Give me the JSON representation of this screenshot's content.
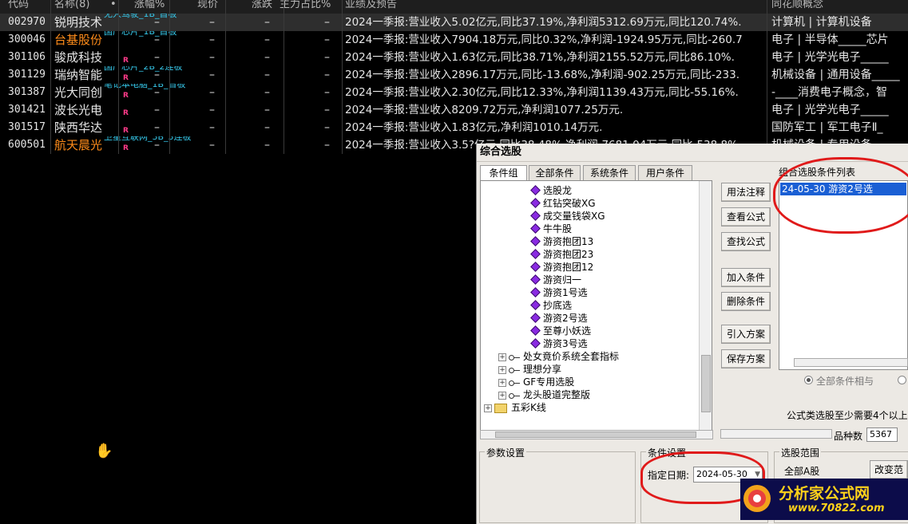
{
  "table": {
    "headers": [
      "代码",
      "名称(8)",
      "•",
      "涨幅%",
      "现价",
      "涨跌",
      "主力占比%",
      "业绩及预告",
      "同花顺概念"
    ],
    "rows": [
      {
        "code": "002970",
        "name": "锐明技术",
        "tag": "无人驾驶_1B_首板",
        "r": "",
        "zf": "–",
        "xj": "–",
        "zd": "–",
        "zl": "–",
        "perf": "2024一季报:营业收入5.02亿元,同比37.19%,净利润5312.69万元,同比120.74%.",
        "concept": "计算机 | 计算机设备",
        "name_color": "white",
        "selected": true
      },
      {
        "code": "300046",
        "name": "台基股份",
        "tag": "国产芯片_1B_首板",
        "r": "",
        "zf": "–",
        "xj": "–",
        "zd": "–",
        "zl": "–",
        "perf": "2024一季报:营业收入7904.18万元,同比0.32%,净利润-1924.95万元,同比-260.7",
        "concept": "电子 | 半导体_____芯片",
        "name_color": "orange",
        "selected": false
      },
      {
        "code": "301106",
        "name": "骏成科技",
        "tag": "",
        "r": "R",
        "zf": "–",
        "xj": "–",
        "zd": "–",
        "zl": "–",
        "perf": "2024一季报:营业收入1.63亿元,同比38.71%,净利润2155.52万元,同比86.10%.",
        "concept": "电子 | 光学光电子_____",
        "name_color": "white",
        "selected": false
      },
      {
        "code": "301129",
        "name": "瑞纳智能",
        "tag": "国产芯片_2B_2连板",
        "r": "R",
        "zf": "–",
        "xj": "–",
        "zd": "–",
        "zl": "–",
        "perf": "2024一季报:营业收入2896.17万元,同比-13.68%,净利润-902.25万元,同比-233.",
        "concept": "机械设备 | 通用设备_____",
        "name_color": "white",
        "selected": false
      },
      {
        "code": "301387",
        "name": "光大同创",
        "tag": "笔记本电脑_1B_首板",
        "r": "R",
        "zf": "–",
        "xj": "–",
        "zd": "–",
        "zl": "–",
        "perf": "2024一季报:营业收入2.30亿元,同比12.33%,净利润1139.43万元,同比-55.16%.",
        "concept": "-____消费电子概念，智",
        "name_color": "white",
        "selected": false
      },
      {
        "code": "301421",
        "name": "波长光电",
        "tag": "",
        "r": "R",
        "zf": "–",
        "xj": "–",
        "zd": "–",
        "zl": "–",
        "perf": "2024一季报:营业收入8209.72万元,净利润1077.25万元.",
        "concept": "电子 | 光学光电子_____",
        "name_color": "white",
        "selected": false
      },
      {
        "code": "301517",
        "name": "陕西华达",
        "tag": "",
        "r": "R",
        "zf": "–",
        "xj": "–",
        "zd": "–",
        "zl": "–",
        "perf": "2024一季报:营业收入1.83亿元,净利润1010.14万元.",
        "concept": "国防军工 | 军工电子Ⅱ_",
        "name_color": "white",
        "selected": false
      },
      {
        "code": "600501",
        "name": "航天晨光",
        "tag": "卫星互联网_3B_3连板",
        "r": "R",
        "zf": "–",
        "xj": "–",
        "zd": "–",
        "zl": "–",
        "perf": "2024一季报:营业收入3.5?亿元,同比38.48%,净利润-7681.04万元,同比-538.8%",
        "concept": "机械设备 | 专用设备",
        "name_color": "orange",
        "selected": false
      }
    ]
  },
  "dialog": {
    "title": "综合选股",
    "tabs": [
      "条件组",
      "全部条件",
      "系统条件",
      "用户条件"
    ],
    "tree_items": [
      {
        "label": "选股龙",
        "kind": "formula"
      },
      {
        "label": "红钻突破XG",
        "kind": "formula"
      },
      {
        "label": "成交量钱袋XG",
        "kind": "formula"
      },
      {
        "label": "牛牛股",
        "kind": "formula"
      },
      {
        "label": "游资抱团13",
        "kind": "formula"
      },
      {
        "label": "游资抱团23",
        "kind": "formula"
      },
      {
        "label": "游资抱团12",
        "kind": "formula"
      },
      {
        "label": "游资归一",
        "kind": "formula"
      },
      {
        "label": "游资1号选",
        "kind": "formula"
      },
      {
        "label": "抄底选",
        "kind": "formula"
      },
      {
        "label": "游资2号选",
        "kind": "formula"
      },
      {
        "label": "至尊小妖选",
        "kind": "formula"
      },
      {
        "label": "游资3号选",
        "kind": "formula"
      },
      {
        "label": "处女竟价系统全套指标",
        "kind": "group"
      },
      {
        "label": "理想分享",
        "kind": "group"
      },
      {
        "label": "GF专用选股",
        "kind": "group"
      },
      {
        "label": "龙头股道完整版",
        "kind": "group"
      },
      {
        "label": "五彩K线",
        "kind": "folder"
      }
    ],
    "buttons": [
      "用法注释",
      "查看公式",
      "查找公式",
      "加入条件",
      "删除条件",
      "引入方案",
      "保存方案"
    ],
    "list_title": "组合选股条件列表",
    "list_items": [
      "24-05-30 游资2号选"
    ],
    "radio_all": "全部条件相与",
    "formula_note": "公式类选股至少需要4个以上",
    "stock_count_label": "品种数",
    "stock_count": "5367",
    "param_group": "参数设置",
    "cond_group": "条件设置",
    "date_label": "指定日期:",
    "date_value": "2024-05-30",
    "range_group": "选股范围",
    "range_value": "全部A股",
    "change_range_button": "改变范"
  },
  "logo": {
    "text": "分析家公式网",
    "url": "www.70822.com"
  },
  "colors": {
    "accent_red": "#e01a1a",
    "selection_blue": "#1a5fd4",
    "tag_cyan": "#35c6e8",
    "name_orange": "#ff8c1a"
  }
}
